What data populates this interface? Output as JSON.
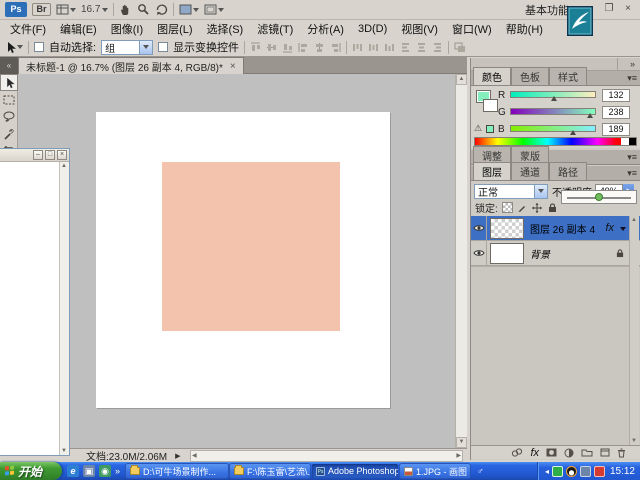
{
  "app": {
    "ps_badge": "Ps",
    "br_badge": "Br",
    "zoom_level": "16.7",
    "workspace_label": "基本功能",
    "window": {
      "minimize": "–",
      "restore": "❐",
      "close": "×"
    }
  },
  "menu_bar": {
    "items": [
      "文件(F)",
      "编辑(E)",
      "图像(I)",
      "图层(L)",
      "选择(S)",
      "滤镜(T)",
      "分析(A)",
      "3D(D)",
      "视图(V)",
      "窗口(W)",
      "帮助(H)"
    ]
  },
  "options_bar": {
    "auto_select_label": "自动选择:",
    "auto_select_value": "组",
    "show_transform_label": "显示变换控件"
  },
  "document": {
    "tab_title": "未标题-1 @ 16.7% (图层 26 副本 4, RGB/8)*",
    "tab_close": "×",
    "square_color": "#f4c3ae"
  },
  "color_panel": {
    "tabs": [
      "颜色",
      "色板",
      "样式"
    ],
    "foreground_color": "#84eebd",
    "background_color": "#ffffff",
    "channels": [
      {
        "label": "R",
        "value": "132"
      },
      {
        "label": "G",
        "value": "238"
      },
      {
        "label": "B",
        "value": "189"
      }
    ],
    "gamut_warning": "⚠"
  },
  "adjustments_group": {
    "tabs": [
      "调整",
      "蒙版"
    ]
  },
  "layers_panel": {
    "tabs": [
      "图层",
      "通道",
      "路径"
    ],
    "blend_mode": "正常",
    "opacity_label": "不透明度:",
    "opacity_value": "49%",
    "lock_label": "锁定:",
    "fx_badge": "fx",
    "layers": [
      {
        "name": "图层 26 副本 4"
      },
      {
        "name": "背景"
      }
    ]
  },
  "status_bar": {
    "doc_info": "文档:23.0M/2.06M"
  },
  "taskbar": {
    "start_label": "开始",
    "quick_launch_overflow": "»",
    "tasks": [
      {
        "label": "D:\\可牛场景制作..."
      },
      {
        "label": "F:\\陈玉雷\\艺流\\..."
      },
      {
        "label": "Adobe Photoshop..."
      },
      {
        "label": "1.JPG - 画图"
      }
    ],
    "clock": "15:12"
  }
}
